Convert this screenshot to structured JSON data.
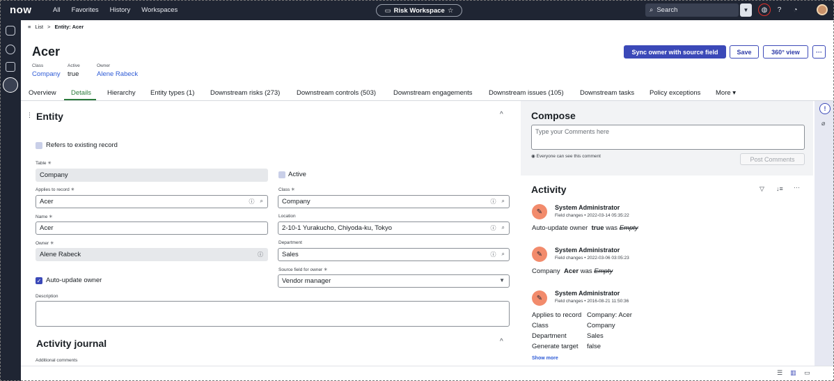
{
  "topnav": {
    "logo": "now",
    "links": [
      "All",
      "Favorites",
      "History",
      "Workspaces"
    ],
    "workspace": "Risk Workspace",
    "workspace_star": "☆",
    "search_placeholder": "Search",
    "icons": [
      "globe-icon",
      "help-icon",
      "bell-icon",
      "avatar"
    ]
  },
  "breadcrumb": {
    "list": "List",
    "separator": ">",
    "current": "Entity: Acer"
  },
  "header": {
    "title": "Acer",
    "meta": [
      {
        "label": "Class",
        "value": "Company",
        "is_link": true
      },
      {
        "label": "Active",
        "value": "true",
        "is_link": false
      },
      {
        "label": "Owner",
        "value": "Alene Rabeck",
        "is_link": true
      }
    ],
    "buttons": {
      "sync": "Sync owner with source field",
      "save": "Save",
      "view360": "360° view",
      "more": "···"
    }
  },
  "tabs": [
    "Overview",
    "Details",
    "Hierarchy",
    "Entity types (1)",
    "Downstream risks (273)",
    "Downstream controls (503)",
    "Downstream engagements",
    "Downstream issues (105)",
    "Downstream tasks",
    "Policy exceptions",
    "More"
  ],
  "entity_section": {
    "title": "Entity",
    "refers_label": "Refers to existing record",
    "table_label": "Table",
    "table_value": "Company",
    "active_label": "Active",
    "applies_label": "Applies to record",
    "applies_value": "Acer",
    "class_label": "Class",
    "class_value": "Company",
    "name_label": "Name",
    "name_value": "Acer",
    "location_label": "Location",
    "location_value": "2-10-1 Yurakucho, Chiyoda-ku, Tokyo",
    "owner_label": "Owner",
    "owner_value": "Alene Rabeck",
    "department_label": "Department",
    "department_value": "Sales",
    "source_label": "Source field for owner",
    "source_value": "Vendor manager",
    "auto_update_label": "Auto-update owner",
    "description_label": "Description",
    "required_mark": "✳"
  },
  "journal_section": {
    "title": "Activity journal",
    "additional_label": "Additional comments"
  },
  "compose": {
    "title": "Compose",
    "placeholder": "Type your Comments here",
    "visibility_note": "Everyone can see this comment",
    "post_button": "Post Comments"
  },
  "activity": {
    "title": "Activity",
    "entries": [
      {
        "author": "System Administrator",
        "meta": "Field changes • 2022-03-14 05:35:22",
        "field": "Auto-update owner",
        "value": "true",
        "was": "was",
        "old": "Empty"
      },
      {
        "author": "System Administrator",
        "meta": "Field changes • 2022-03-06 03:05:23",
        "field": "Company",
        "value": "Acer",
        "was": "was",
        "old": "Empty"
      },
      {
        "author": "System Administrator",
        "meta": "Field changes • 2016-08-21 11:50:36"
      }
    ],
    "details": [
      {
        "field": "Applies to record",
        "value": "Company: Acer"
      },
      {
        "field": "Class",
        "value": "Company"
      },
      {
        "field": "Department",
        "value": "Sales"
      },
      {
        "field": "Generate target",
        "value": "false"
      }
    ],
    "show_more": "Show more"
  },
  "colors": {
    "nav_bg": "#1f2533",
    "primary": "#3b49b8",
    "tab_active": "#2a7a3a",
    "link": "#2e5bd6",
    "avatar": "#f28b6c"
  }
}
